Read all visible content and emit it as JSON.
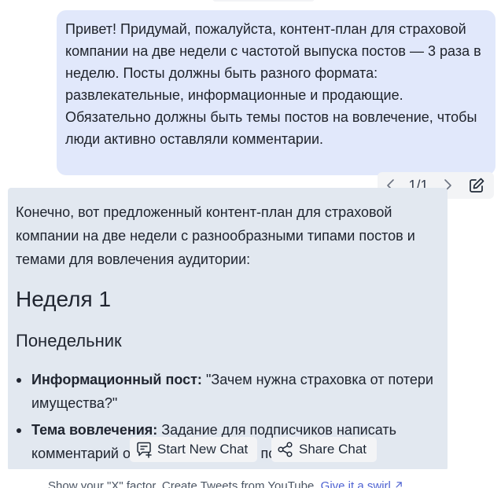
{
  "user_message": {
    "text": "Привет! Придумай, пожалуйста, контент-план для страховой компании на две недели с частотой выпуска постов — 3 раза в неделю. Посты должны быть разного формата: развлекательные, информационные и продающие. Обязательно должны быть темы постов на вовлечение, чтобы люди активно оставляли комментарии."
  },
  "message_controls": {
    "pager": "1/1",
    "prev_icon": "chevron-left-icon",
    "next_icon": "chevron-right-icon",
    "edit_icon": "edit-icon"
  },
  "assistant_message": {
    "intro": "Конечно, вот предложенный контент-план для страховой компании на две недели с разнообразными типами постов и темами для вовлечения аудитории:",
    "heading_week": "Неделя 1",
    "heading_day": "Понедельник",
    "items": [
      {
        "label": "Информационный пост:",
        "text": " \"Зачем нужна страховка от потери имущества?\""
      },
      {
        "label": "Тема вовлечения:",
        "text": " Задание для подписчиков написать комментарий о том, как страховка помогла"
      }
    ]
  },
  "actions": {
    "new_chat_label": "Start New Chat",
    "new_chat_icon": "chat-plus-icon",
    "share_chat_label": "Share Chat",
    "share_chat_icon": "share-icon"
  },
  "footer": {
    "promo_text": "Show your \"X\" factor. Create Tweets from YouTube.",
    "promo_link": "Give it a swirl",
    "link_icon": "external-link-icon"
  },
  "colors": {
    "user_bubble": "#e1e8fb",
    "assistant_bubble": "#e2e8f0",
    "link": "#4f63d2"
  }
}
